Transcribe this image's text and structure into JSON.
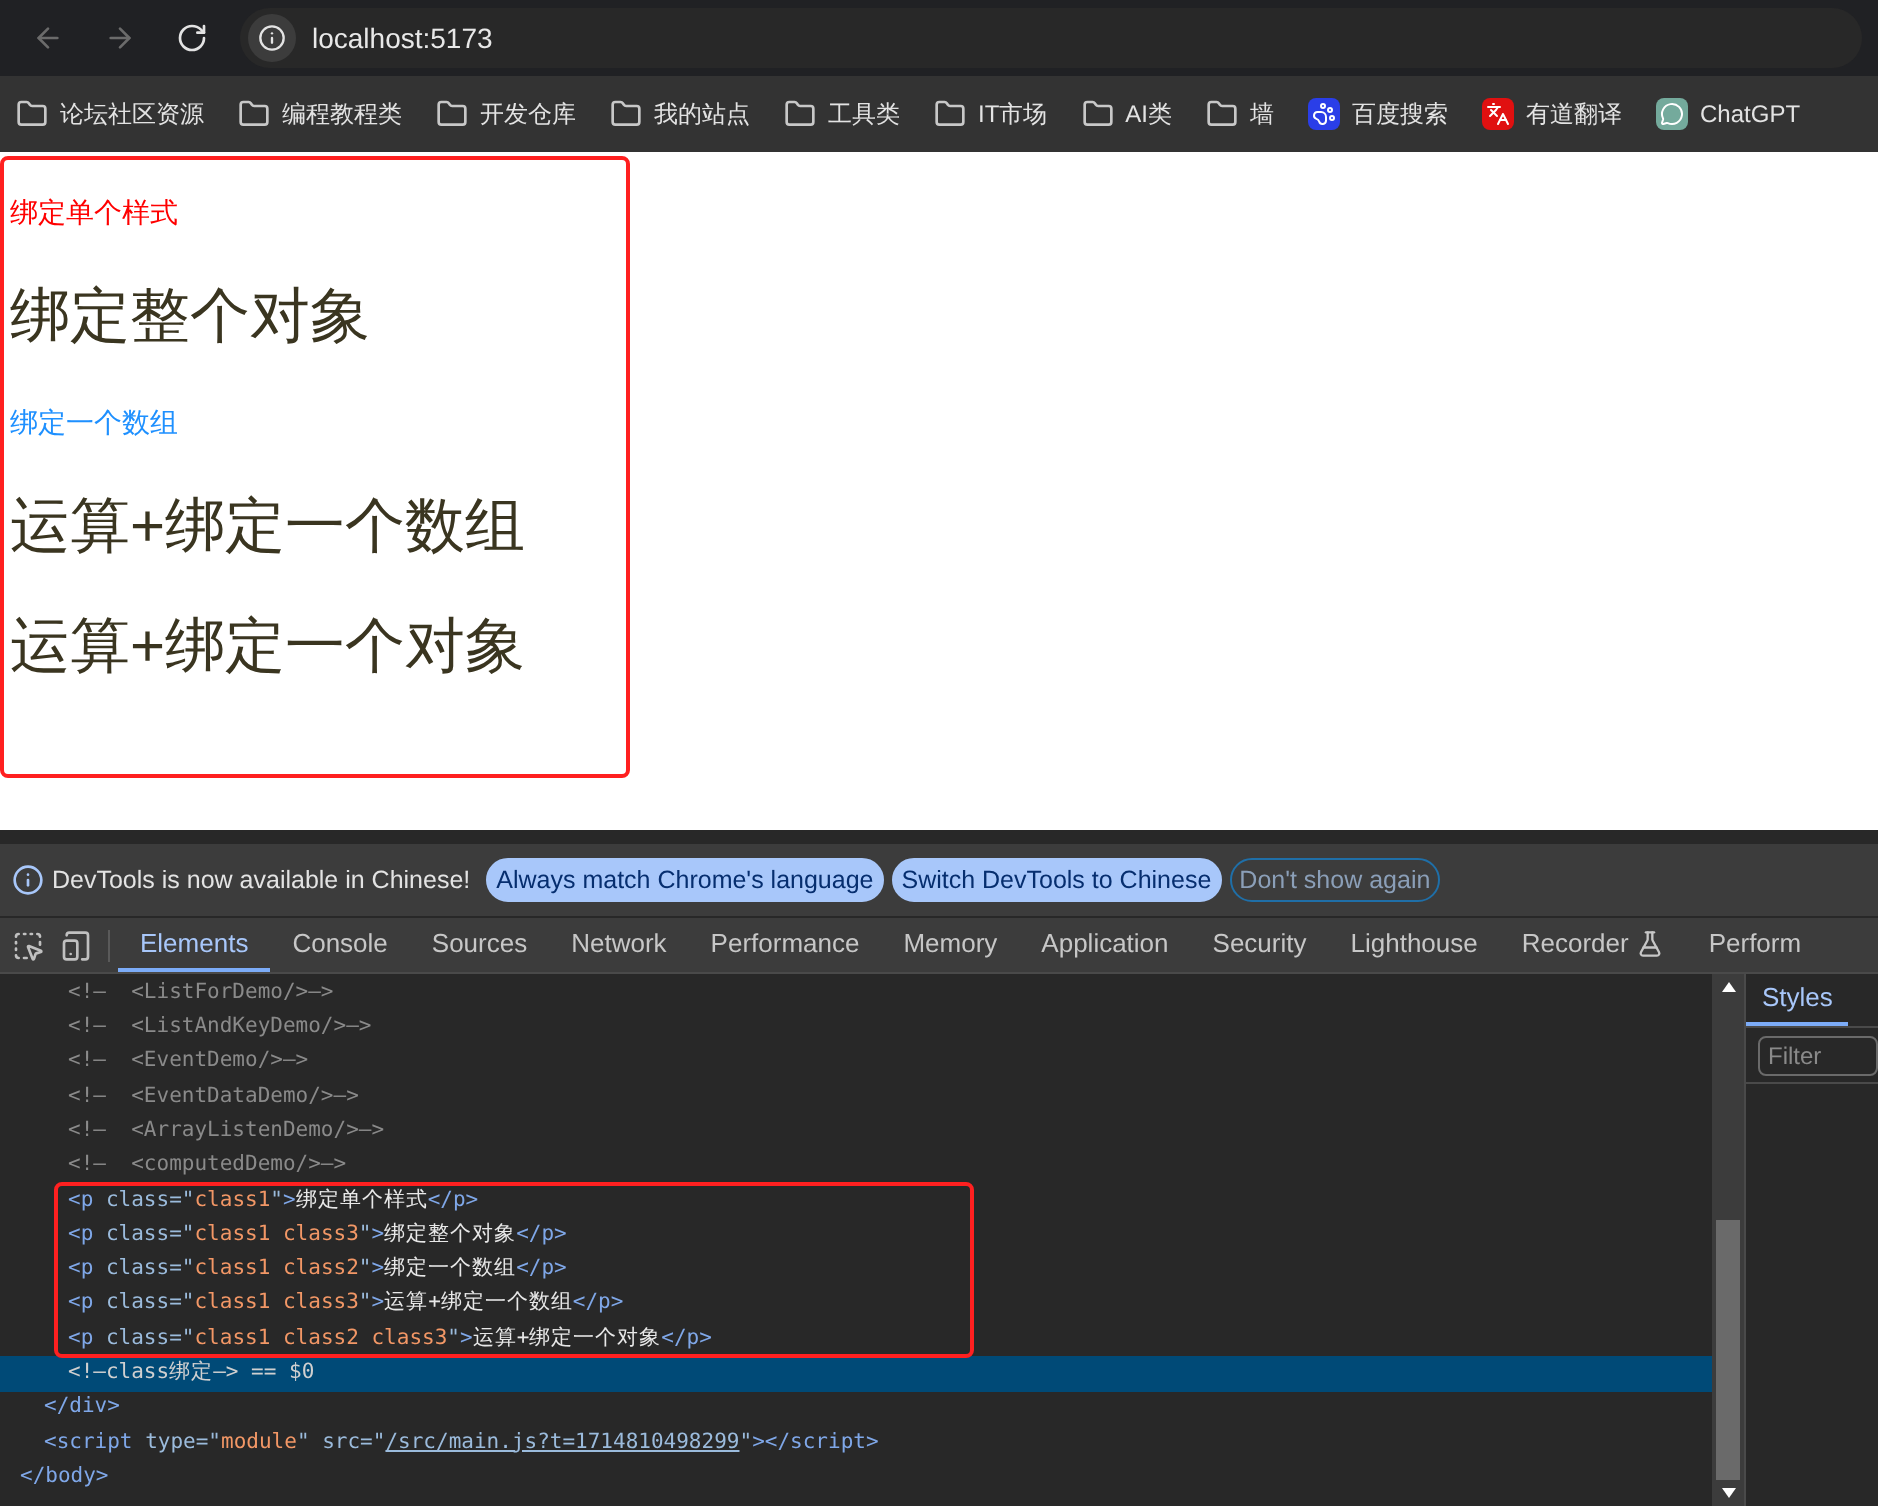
{
  "browser": {
    "nav_buttons": [
      {
        "kind": "back",
        "disabled": true
      },
      {
        "kind": "forward",
        "disabled": true
      },
      {
        "kind": "reload",
        "disabled": false
      }
    ],
    "address": "localhost:5173",
    "bookmarks": [
      {
        "kind": "folder",
        "label": "论坛社区资源"
      },
      {
        "kind": "folder",
        "label": "编程教程类"
      },
      {
        "kind": "folder",
        "label": "开发仓库"
      },
      {
        "kind": "folder",
        "label": "我的站点"
      },
      {
        "kind": "folder",
        "label": "工具类"
      },
      {
        "kind": "folder",
        "label": "IT市场"
      },
      {
        "kind": "folder",
        "label": "AI类"
      },
      {
        "kind": "folder",
        "label": "墙"
      },
      {
        "kind": "paw",
        "label": "百度搜索"
      },
      {
        "kind": "translate",
        "label": "有道翻译"
      },
      {
        "kind": "chat",
        "label": "ChatGPT"
      }
    ]
  },
  "page": {
    "paragraphs": [
      {
        "kind": "small_red",
        "text": "绑定单个样式"
      },
      {
        "kind": "large",
        "text": "绑定整个对象"
      },
      {
        "kind": "small_blue",
        "text": "绑定一个数组"
      },
      {
        "kind": "large",
        "text": "运算+绑定一个数组"
      },
      {
        "kind": "large",
        "text": "运算+绑定一个对象"
      }
    ]
  },
  "devtools": {
    "infobar": {
      "message": "DevTools is now available in Chinese!",
      "buttons": [
        {
          "kind": "filled",
          "label": "Always match Chrome's language"
        },
        {
          "kind": "filled",
          "label": "Switch DevTools to Chinese"
        },
        {
          "kind": "outline",
          "label": "Don't show again"
        }
      ]
    },
    "tabs": [
      {
        "label": "Elements",
        "selected": true
      },
      {
        "label": "Console",
        "selected": false
      },
      {
        "label": "Sources",
        "selected": false
      },
      {
        "label": "Network",
        "selected": false
      },
      {
        "label": "Performance",
        "selected": false
      },
      {
        "label": "Memory",
        "selected": false
      },
      {
        "label": "Application",
        "selected": false
      },
      {
        "label": "Security",
        "selected": false
      },
      {
        "label": "Lighthouse",
        "selected": false
      },
      {
        "label": "Recorder",
        "selected": false
      },
      {
        "label": "Perform",
        "selected": false
      }
    ],
    "dom_tree": [
      {
        "children": [
          {
            "children": [
              {
                "selected": false,
                "tokens": [
                  {
                    "kind": "comment",
                    "text": "<!—  <ListForDemo/>—>"
                  }
                ]
              },
              {
                "selected": false,
                "tokens": [
                  {
                    "kind": "comment",
                    "text": "<!—  <ListAndKeyDemo/>—>"
                  }
                ]
              },
              {
                "selected": false,
                "tokens": [
                  {
                    "kind": "comment",
                    "text": "<!—  <EventDemo/>—>"
                  }
                ]
              },
              {
                "selected": false,
                "tokens": [
                  {
                    "kind": "comment",
                    "text": "<!—  <EventDataDemo/>—>"
                  }
                ]
              },
              {
                "selected": false,
                "tokens": [
                  {
                    "kind": "comment",
                    "text": "<!—  <ArrayListenDemo/>—>"
                  }
                ]
              },
              {
                "selected": false,
                "tokens": [
                  {
                    "kind": "comment",
                    "text": "<!—  <computedDemo/>—>"
                  }
                ]
              },
              {
                "selected": false,
                "tokens": [
                  {
                    "kind": "tag",
                    "text": "<p "
                  },
                  {
                    "kind": "attr",
                    "text": "class=\""
                  },
                  {
                    "kind": "value",
                    "text": "class1"
                  },
                  {
                    "kind": "attr",
                    "text": "\""
                  },
                  {
                    "kind": "tag",
                    "text": ">"
                  },
                  {
                    "kind": "text",
                    "text": "绑定单个样式"
                  },
                  {
                    "kind": "tag",
                    "text": "</p>"
                  }
                ]
              },
              {
                "selected": false,
                "tokens": [
                  {
                    "kind": "tag",
                    "text": "<p "
                  },
                  {
                    "kind": "attr",
                    "text": "class=\""
                  },
                  {
                    "kind": "value",
                    "text": "class1 class3"
                  },
                  {
                    "kind": "attr",
                    "text": "\""
                  },
                  {
                    "kind": "tag",
                    "text": ">"
                  },
                  {
                    "kind": "text",
                    "text": "绑定整个对象"
                  },
                  {
                    "kind": "tag",
                    "text": "</p>"
                  }
                ]
              },
              {
                "selected": false,
                "tokens": [
                  {
                    "kind": "tag",
                    "text": "<p "
                  },
                  {
                    "kind": "attr",
                    "text": "class=\""
                  },
                  {
                    "kind": "value",
                    "text": "class1 class2"
                  },
                  {
                    "kind": "attr",
                    "text": "\""
                  },
                  {
                    "kind": "tag",
                    "text": ">"
                  },
                  {
                    "kind": "text",
                    "text": "绑定一个数组"
                  },
                  {
                    "kind": "tag",
                    "text": "</p>"
                  }
                ]
              },
              {
                "selected": false,
                "tokens": [
                  {
                    "kind": "tag",
                    "text": "<p "
                  },
                  {
                    "kind": "attr",
                    "text": "class=\""
                  },
                  {
                    "kind": "value",
                    "text": "class1 class3"
                  },
                  {
                    "kind": "attr",
                    "text": "\""
                  },
                  {
                    "kind": "tag",
                    "text": ">"
                  },
                  {
                    "kind": "text",
                    "text": "运算+绑定一个数组"
                  },
                  {
                    "kind": "tag",
                    "text": "</p>"
                  }
                ]
              },
              {
                "selected": false,
                "tokens": [
                  {
                    "kind": "tag",
                    "text": "<p "
                  },
                  {
                    "kind": "attr",
                    "text": "class=\""
                  },
                  {
                    "kind": "value",
                    "text": "class1 class2 class3"
                  },
                  {
                    "kind": "attr",
                    "text": "\""
                  },
                  {
                    "kind": "tag",
                    "text": ">"
                  },
                  {
                    "kind": "text",
                    "text": "运算+绑定一个对象"
                  },
                  {
                    "kind": "tag",
                    "text": "</p>"
                  }
                ]
              },
              {
                "selected": true,
                "tokens": [
                  {
                    "kind": "comment",
                    "text": "<!—class绑定—> == $0"
                  }
                ]
              }
            ]
          },
          {
            "selected": false,
            "tokens": [
              {
                "kind": "tag",
                "text": "</div>"
              }
            ]
          },
          {
            "selected": false,
            "tokens": [
              {
                "kind": "tag",
                "text": "<script "
              },
              {
                "kind": "attr",
                "text": "type=\""
              },
              {
                "kind": "value",
                "text": "module"
              },
              {
                "kind": "attr",
                "text": "\" src=\""
              },
              {
                "kind": "link",
                "text": "/src/main.js?t=1714810498299"
              },
              {
                "kind": "attr",
                "text": "\""
              },
              {
                "kind": "tag",
                "text": "></script>"
              }
            ]
          }
        ]
      },
      {
        "selected": false,
        "tokens": [
          {
            "kind": "tag",
            "text": "</body>"
          }
        ]
      }
    ],
    "side_tabs": [
      {
        "label": "Styles",
        "selected": true
      }
    ],
    "filter": {
      "placeholder": "Filter"
    }
  }
}
